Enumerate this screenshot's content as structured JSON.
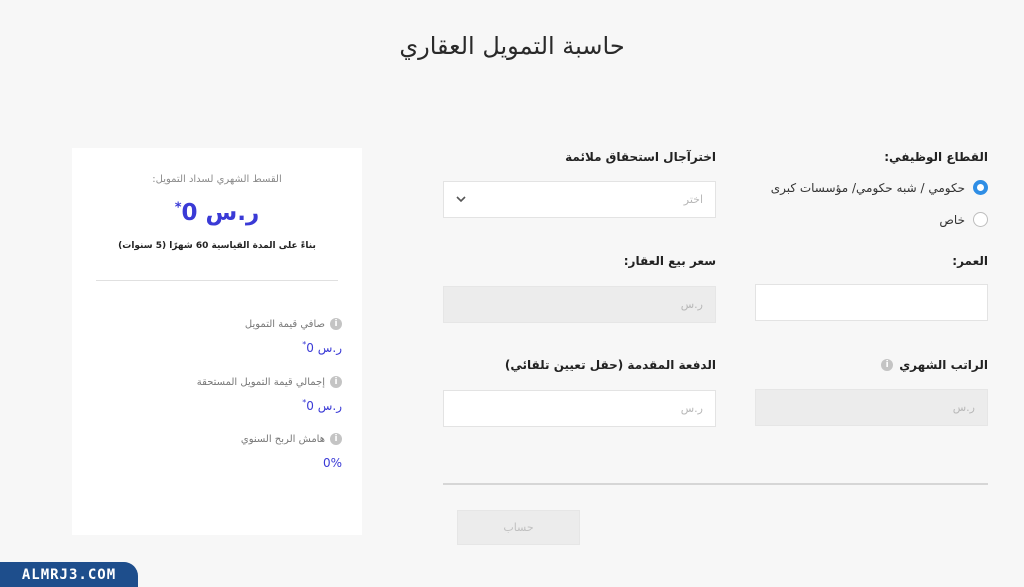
{
  "page_title": "حاسبة التمويل العقاري",
  "form": {
    "sector": {
      "label": "القطاع الوظيفي:",
      "options": [
        {
          "label": "حكومي / شبه حكومي/ مؤسسات كبرى",
          "checked": true
        },
        {
          "label": "خاص",
          "checked": false
        }
      ]
    },
    "term": {
      "label": "اخترآجال استحقاق ملائمة",
      "placeholder": "اختر"
    },
    "age": {
      "label": "العمر:",
      "value": ""
    },
    "property_price": {
      "label": "سعر بيع العقار:",
      "placeholder": "ر.س"
    },
    "salary": {
      "label": "الراتب الشهري",
      "placeholder": "ر.س"
    },
    "down_payment": {
      "label": "الدفعة المقدمة (حقل تعيين تلقائي)",
      "placeholder": "ر.س"
    },
    "calculate_label": "حساب"
  },
  "result_card": {
    "subtitle": "القسط الشهري لسداد التمويل:",
    "amount": "ر.س 0",
    "amount_mark": "*",
    "note": "بناءً على المدة القياسية 60 شهرًا (5 سنوات)",
    "items": [
      {
        "label": "صافي قيمة التمويل",
        "value": "ر.س 0",
        "mark": "*"
      },
      {
        "label": "إجمالي قيمة التمويل المستحقة",
        "value": "ر.س 0",
        "mark": "*"
      },
      {
        "label": "هامش الربح السنوي",
        "value": "0%",
        "mark": ""
      }
    ]
  },
  "icons": {
    "info": "info-icon",
    "dropdown": "chevron-down-icon"
  },
  "colors": {
    "accent": "#2f8ee5",
    "amount": "#3a3ad6"
  },
  "watermark": "ALMRJ3.COM"
}
